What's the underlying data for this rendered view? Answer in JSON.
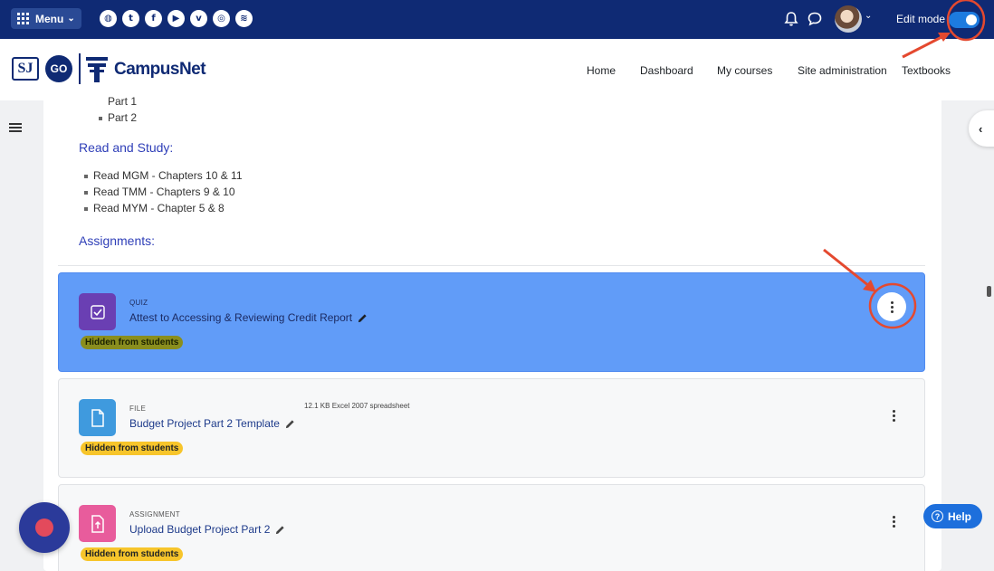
{
  "topbar": {
    "menu_label": "Menu",
    "menu_caret": "⌄",
    "social_links": [
      {
        "name": "globe-icon",
        "glyph": "◍"
      },
      {
        "name": "twitter-icon",
        "glyph": "t"
      },
      {
        "name": "facebook-icon",
        "glyph": "f"
      },
      {
        "name": "youtube-icon",
        "glyph": "▶"
      },
      {
        "name": "vimeo-icon",
        "glyph": "v"
      },
      {
        "name": "instagram-icon",
        "glyph": "◎"
      },
      {
        "name": "rss-icon",
        "glyph": "≋"
      }
    ],
    "notification_glyph": "🔔",
    "messages_glyph": "💬",
    "avatar_caret": "⌄",
    "edit_mode_label": "Edit mode",
    "edit_mode_on": true
  },
  "navbar": {
    "logo_sj": "SJ",
    "logo_go": "GO",
    "site_name": "CampusNet",
    "links": [
      "Home",
      "Dashboard",
      "My courses",
      "Site administration",
      "Textbooks"
    ]
  },
  "section": {
    "parts": [
      "Part 1",
      "Part 2"
    ],
    "read_heading": "Read and Study:",
    "readings": [
      "Read MGM - Chapters 10 & 11",
      "Read TMM - Chapters 9 & 10",
      "Read MYM - Chapter 5 & 8"
    ],
    "assignments_heading": "Assignments:"
  },
  "activities": [
    {
      "type": "QUIZ",
      "name": "Attest to Accessing & Reviewing Credit Report",
      "badge": "Hidden from students",
      "selected": true,
      "icon_color": "#6a3fb3",
      "meta": ""
    },
    {
      "type": "FILE",
      "name": "Budget Project Part 2 Template",
      "badge": "Hidden from students",
      "selected": false,
      "icon_color": "#3f9ade",
      "meta": "12.1 KB Excel 2007 spreadsheet"
    },
    {
      "type": "ASSIGNMENT",
      "name": "Upload Budget Project Part 2",
      "badge": "Hidden from students",
      "selected": false,
      "icon_color": "#e85c9c",
      "meta": ""
    }
  ],
  "help_label": "Help",
  "right_drawer_glyph": "‹",
  "colors": {
    "topbar": "#0f2a74",
    "selected": "#619cf8",
    "badge": "#f7c52b",
    "annotation": "#e4492f"
  }
}
